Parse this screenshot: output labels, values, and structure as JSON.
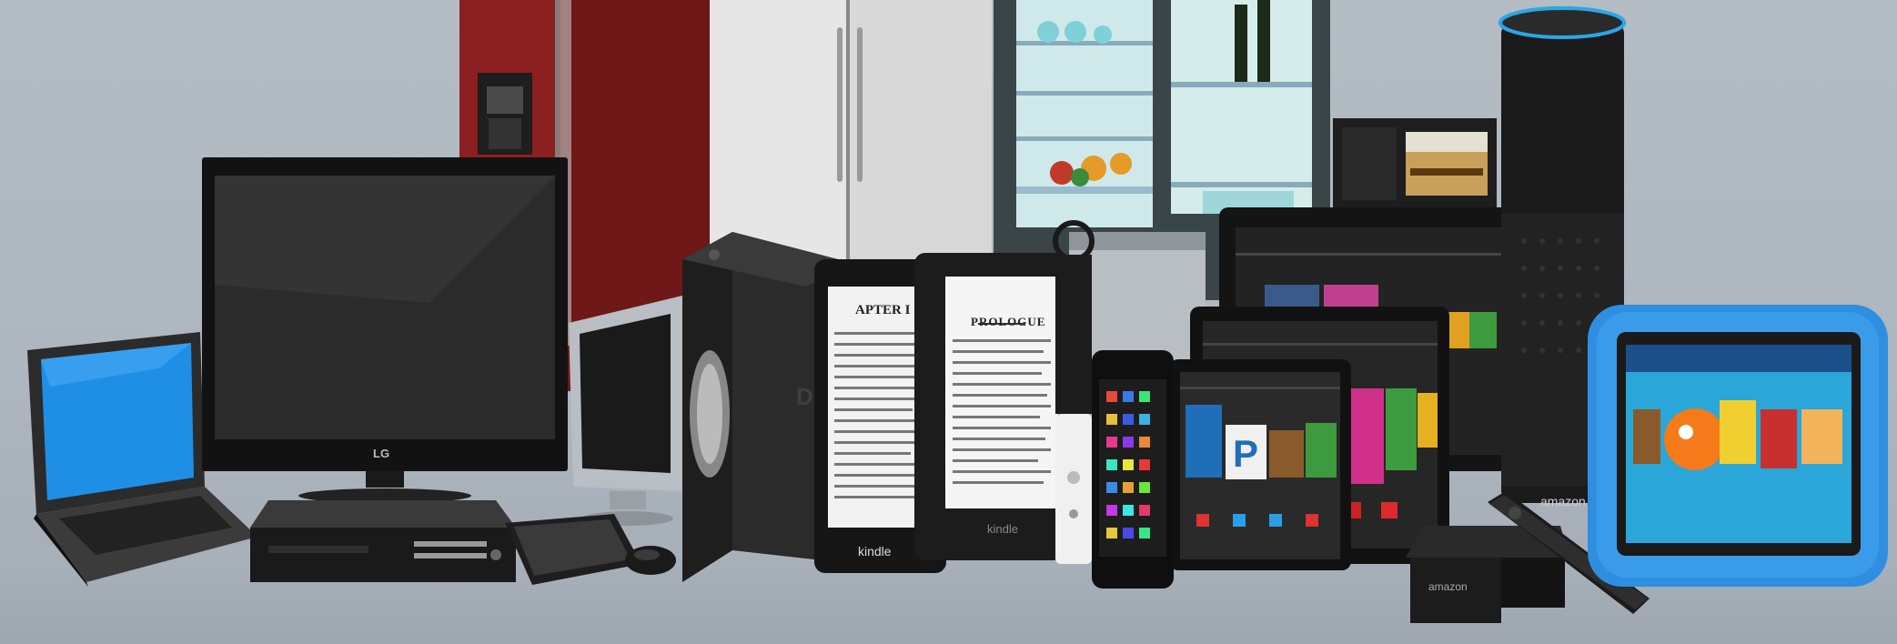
{
  "scene": {
    "description_free": true
  },
  "labels": {
    "tv_brand": "LG",
    "ereader_left_heading": "APTER I",
    "ereader_right_heading": "PROLOGUE",
    "kindle_left": "kindle",
    "kindle_right": "kindle",
    "speaker_brand": "amazon",
    "firestick_box": "amazon"
  },
  "colors": {
    "background": "#b0b8c0",
    "fridge_red": "#6e1a1a",
    "kids_case_blue": "#2f8ee0",
    "laptop_screen": "#1f8fe6",
    "echo_ring": "#2aa7e8"
  }
}
